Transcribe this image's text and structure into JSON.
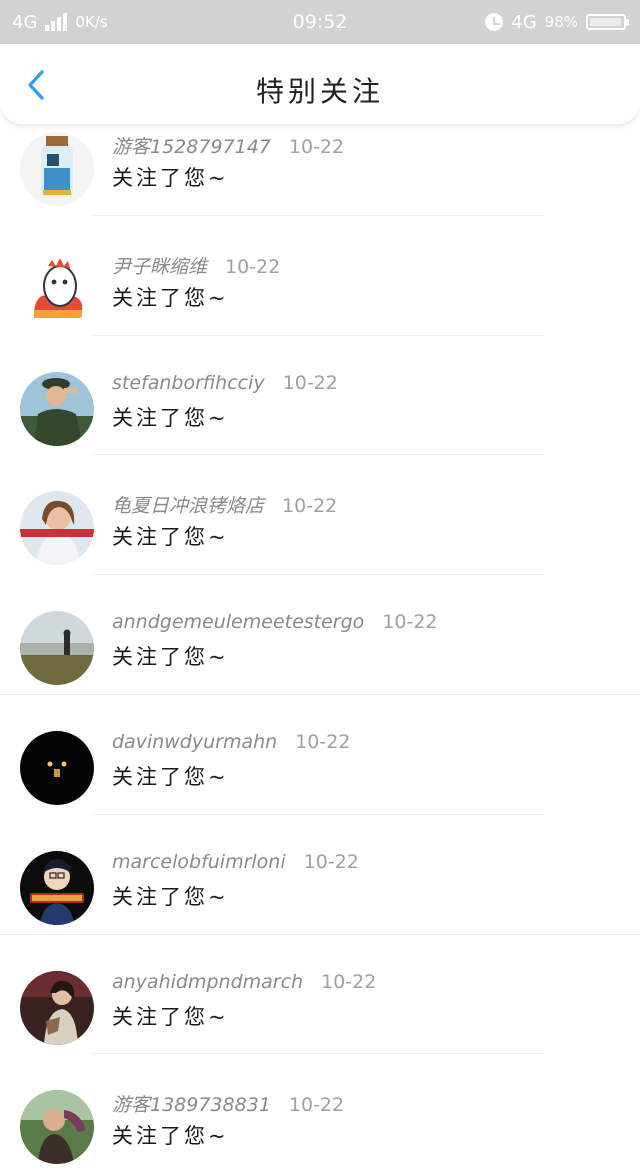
{
  "status_bar": {
    "network_left": "4G",
    "speed": "0K/s",
    "time": "09:52",
    "network_right": "4G",
    "battery": "98%",
    "battery_level": 0.98,
    "bar_color": "#d2d2d2"
  },
  "header": {
    "title": "特别关注",
    "back_icon": "chevron-left-icon",
    "accent": "#2e9bf0"
  },
  "items": [
    {
      "name": "游客1528797147",
      "time": "10-22",
      "message": "关注了您~"
    },
    {
      "name": "尹子眯缩维",
      "time": "10-22",
      "message": "关注了您~"
    },
    {
      "name": "stefanborfihcciy",
      "time": "10-22",
      "message": "关注了您~"
    },
    {
      "name": "龟夏日冲浪铐烙店",
      "time": "10-22",
      "message": "关注了您~"
    },
    {
      "name": "anndgemeulemeetestergo",
      "time": "10-22",
      "message": "关注了您~"
    },
    {
      "name": "davinwdyurmahn",
      "time": "10-22",
      "message": "关注了您~"
    },
    {
      "name": "marcelobfuimrloni",
      "time": "10-22",
      "message": "关注了您~"
    },
    {
      "name": "anyahidmpndmarch",
      "time": "10-22",
      "message": "关注了您~"
    },
    {
      "name": "游客1389738831",
      "time": "10-22",
      "message": "关注了您~"
    }
  ]
}
